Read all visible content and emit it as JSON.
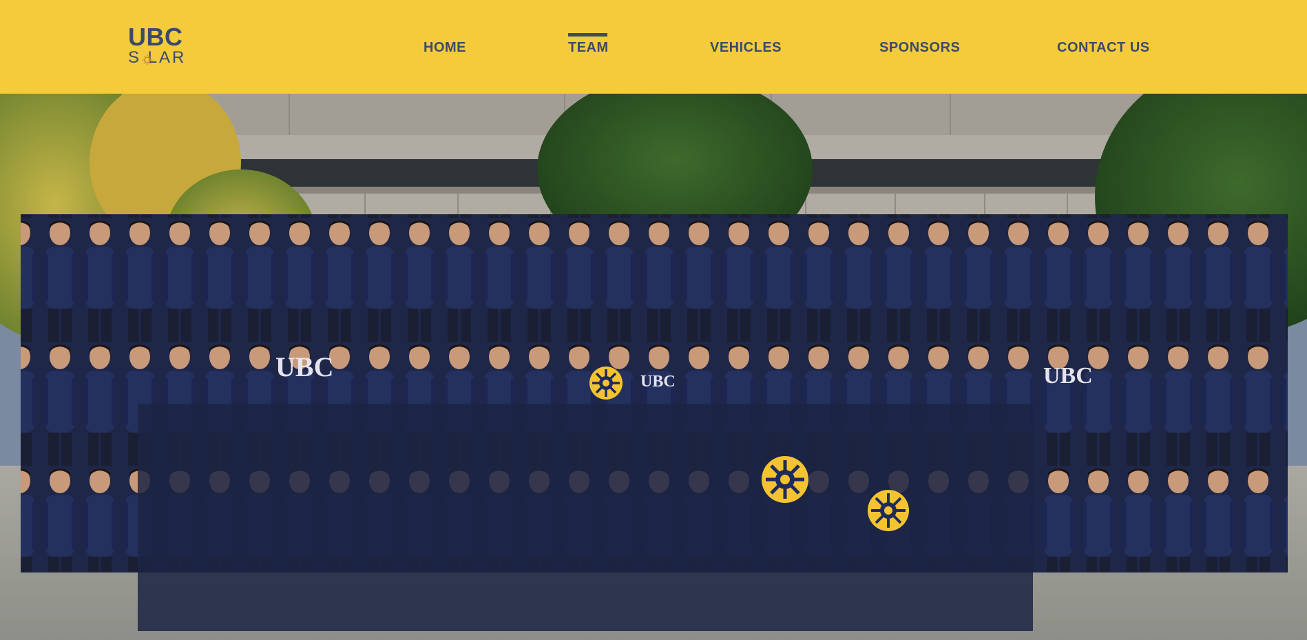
{
  "logo": {
    "line1": "UBC",
    "line2": "S LAR",
    "icon": "sun-icon"
  },
  "nav": {
    "items": [
      {
        "label": "HOME"
      },
      {
        "label": "TEAM"
      },
      {
        "label": "VEHICLES"
      },
      {
        "label": "SPONSORS"
      },
      {
        "label": "CONTACT US"
      }
    ],
    "active": "TEAM"
  },
  "hero": {
    "image": "team-group-photo",
    "shirt_text": [
      "UBC",
      "UBC",
      "UBC"
    ]
  },
  "colors": {
    "nav_background": "#f4cb3b",
    "nav_text": "#3b4a6b",
    "shirt_navy": "#1f2a5c",
    "gear_gold": "#f4c430"
  }
}
